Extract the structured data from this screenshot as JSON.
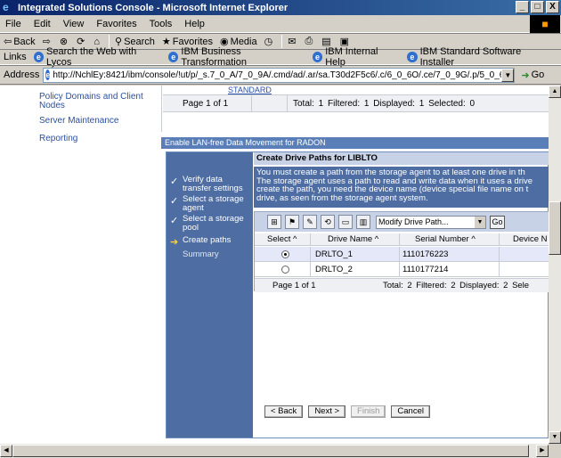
{
  "window": {
    "title": "Integrated Solutions Console - Microsoft Internet Explorer",
    "controls": [
      "_",
      "□",
      "X"
    ]
  },
  "menu": [
    "File",
    "Edit",
    "View",
    "Favorites",
    "Tools",
    "Help"
  ],
  "toolbar": {
    "back": "Back",
    "search": "Search",
    "favorites": "Favorites",
    "media": "Media"
  },
  "links": {
    "label": "Links",
    "items": [
      "Search the Web with Lycos",
      "IBM Business Transformation",
      "IBM Internal Help",
      "IBM Standard Software Installer"
    ]
  },
  "address": {
    "label": "Address",
    "url": "http://NchlEy:8421/ibm/console/!ut/p/_s.7_0_A/7_0_9A/.cmd/ad/.ar/sa.T30d2F5c6/.c/6_0_6O/.ce/7_0_9G/.p/5_0_6T/.c/SFPC_7_0_",
    "go": "Go"
  },
  "nav": {
    "items": [
      "Policy Domains and Client Nodes",
      "Server Maintenance",
      "Reporting"
    ]
  },
  "top_table": {
    "link": "STANDARD",
    "page": "Page 1 of 1",
    "stats": "Total: 1  Filtered: 1  Displayed: 1  Selected: 0"
  },
  "section": {
    "title": "Enable LAN-free Data Movement for RADON"
  },
  "wizard": {
    "steps": [
      {
        "label": "Verify data transfer settings",
        "state": "done"
      },
      {
        "label": "Select a storage agent",
        "state": "done"
      },
      {
        "label": "Select a storage pool",
        "state": "done"
      },
      {
        "label": "Create paths",
        "state": "current"
      },
      {
        "label": "Summary",
        "state": "pending"
      }
    ],
    "title": "Create Drive Paths for LIBLTO",
    "description": [
      "You must create a path from the storage agent to at least one drive in th",
      "The storage agent uses a path to read and write data when it uses a drive",
      "create the path, you need the device name (device special file name on t",
      "drive, as seen from the storage agent system."
    ],
    "action_select": "Modify Drive Path...",
    "go": "Go",
    "columns": [
      "Select",
      "Drive Name",
      "Serial Number",
      "Device N"
    ],
    "rows": [
      {
        "selected": true,
        "drive": "DRLTO_1",
        "serial": "1110176223"
      },
      {
        "selected": false,
        "drive": "DRLTO_2",
        "serial": "1110177214"
      }
    ],
    "footer": {
      "page": "Page 1 of 1",
      "stats": "Total: 2  Filtered: 2  Displayed: 2  Sele"
    },
    "buttons": {
      "back": "< Back",
      "next": "Next >",
      "finish": "Finish",
      "cancel": "Cancel"
    }
  }
}
